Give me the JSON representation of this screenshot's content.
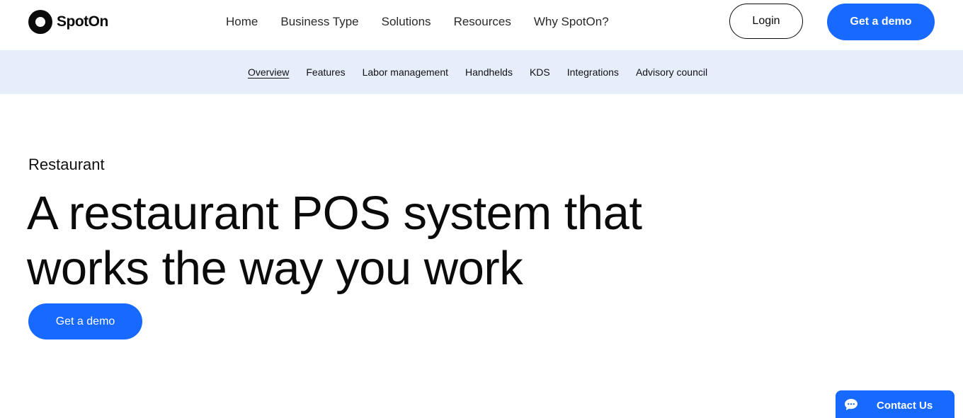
{
  "brand": {
    "name": "SpotOn"
  },
  "nav": {
    "links": [
      "Home",
      "Business Type",
      "Solutions",
      "Resources",
      "Why SpotOn?"
    ],
    "login_label": "Login",
    "demo_label": "Get a demo"
  },
  "subnav": {
    "links": [
      "Overview",
      "Features",
      "Labor management",
      "Handhelds",
      "KDS",
      "Integrations",
      "Advisory council"
    ],
    "active": "Overview"
  },
  "hero": {
    "eyebrow": "Restaurant",
    "headline": "A restaurant POS system that works the way you work",
    "cta_label": "Get a demo"
  },
  "contact_widget": {
    "label": "Contact Us",
    "icon": "chat-bubble-icon"
  },
  "colors": {
    "accent": "#1769ff",
    "subnav_bg": "#e6eefc",
    "text": "#0b0b0b"
  }
}
